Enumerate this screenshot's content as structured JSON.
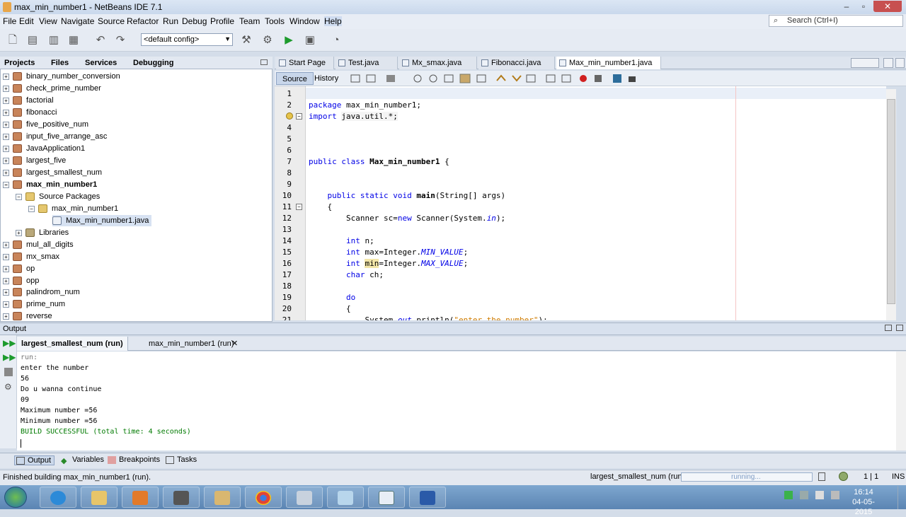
{
  "window": {
    "title": "max_min_number1 - NetBeans IDE 7.1"
  },
  "menu": [
    "File",
    "Edit",
    "View",
    "Navigate",
    "Source",
    "Refactor",
    "Run",
    "Debug",
    "Profile",
    "Team",
    "Tools",
    "Window",
    "Help"
  ],
  "search": {
    "placeholder": "Search (Ctrl+I)"
  },
  "toolbar": {
    "config_value": "<default config>"
  },
  "projects": {
    "tabs": [
      "Projects",
      "Files",
      "Services",
      "Debugging"
    ],
    "items": [
      "binary_number_conversion",
      "check_prime_number",
      "factorial",
      "fibonacci",
      "five_positive_num",
      "input_five_arrange_asc",
      "JavaApplication1",
      "largest_five",
      "largest_smallest_num",
      "max_min_number1",
      "Source Packages",
      "max_min_number1",
      "Max_min_number1.java",
      "Libraries",
      "mul_all_digits",
      "mx_smax",
      "op",
      "opp",
      "palindrom_num",
      "prime_num",
      "reverse"
    ]
  },
  "editor": {
    "tabs": [
      "Start Page",
      "Test.java",
      "Mx_smax.java",
      "Fibonacci.java",
      "Max_min_number1.java"
    ],
    "source_label": "Source",
    "history_label": "History",
    "line_numbers": [
      "1",
      "2",
      "3",
      "4",
      "5",
      "6",
      "7",
      "8",
      "9",
      "10",
      "11",
      "12",
      "13",
      "14",
      "15",
      "16",
      "17",
      "18",
      "19",
      "20",
      "21"
    ]
  },
  "output": {
    "header": "Output",
    "tabs": [
      "largest_smallest_num (run)",
      "max_min_number1 (run)"
    ],
    "lines": [
      "run:",
      "enter the number",
      "56",
      "Do u wanna continue",
      "09",
      "Maximum number =56",
      "Minimum number =56",
      "BUILD SUCCESSFUL (total time: 4 seconds)"
    ],
    "success_color": "#007a00"
  },
  "bottom_tabs": [
    "Output",
    "Variables",
    "Breakpoints",
    "Tasks"
  ],
  "status": {
    "left": "Finished building max_min_number1 (run).",
    "task": "largest_smallest_num (run)",
    "progress_text": "running...",
    "position": "1 | 1",
    "mode": "INS"
  },
  "taskbar": {
    "time": "16:14",
    "date": "04-05-2015"
  }
}
